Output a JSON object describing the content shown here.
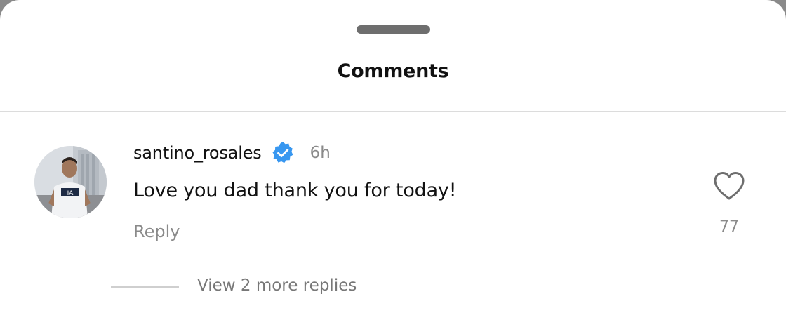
{
  "sheet": {
    "title": "Comments"
  },
  "comment": {
    "username": "santino_rosales",
    "verified": true,
    "time": "6h",
    "text": "Love you dad thank you for today!",
    "reply_label": "Reply",
    "like_count": "77",
    "view_replies_label": "View 2 more replies"
  },
  "colors": {
    "verified_badge": "#3897f0",
    "secondary_text": "#8a8a8a",
    "primary_text": "#111111"
  },
  "icons": {
    "handle": "drag-handle",
    "verified": "verified-badge-icon",
    "like": "heart-outline-icon"
  }
}
